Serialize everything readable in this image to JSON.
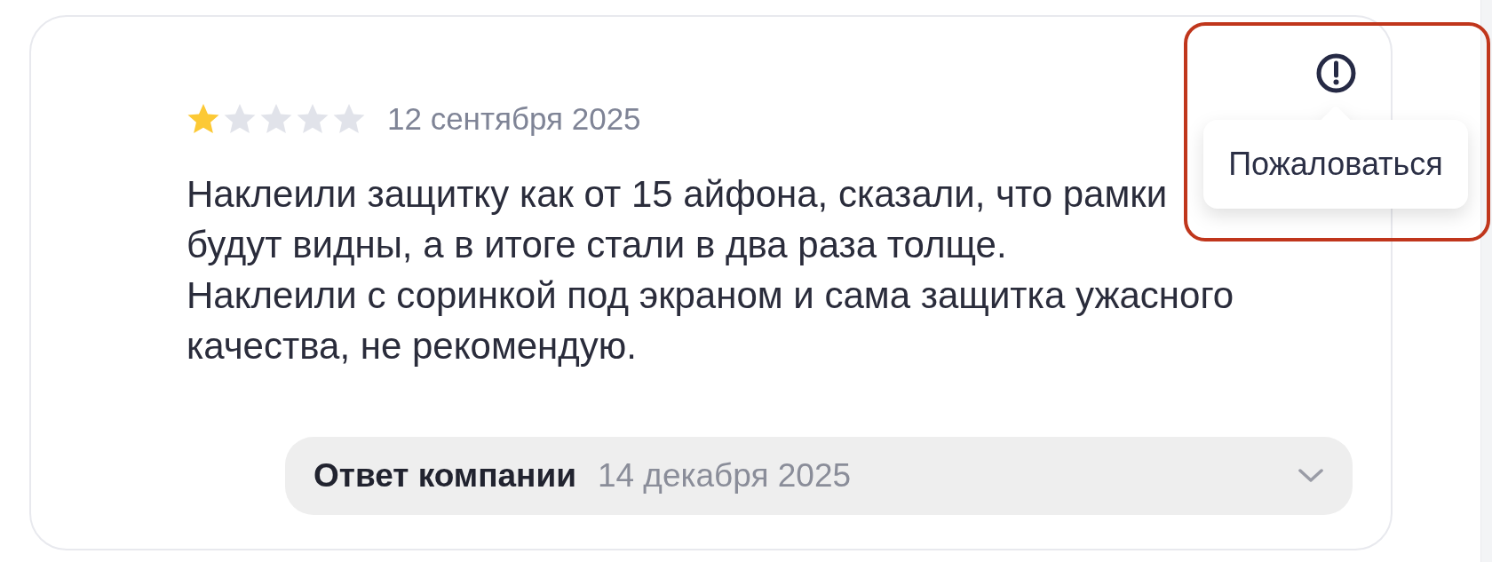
{
  "review": {
    "stars": 1,
    "date": "12 сентября 2025",
    "paragraphs": [
      "Наклеили защитку как от 15 айфона, сказали, что рамки будут видны, а в итоге стали в два раза толще.",
      "Наклеили с соринкой под экраном и сама защитка ужасного качества, не рекомендую."
    ]
  },
  "report": {
    "tooltip": "Пожаловаться",
    "highlighted": true
  },
  "company_reply": {
    "label": "Ответ компании",
    "date": "14 декабря 2025",
    "expanded": false
  }
}
